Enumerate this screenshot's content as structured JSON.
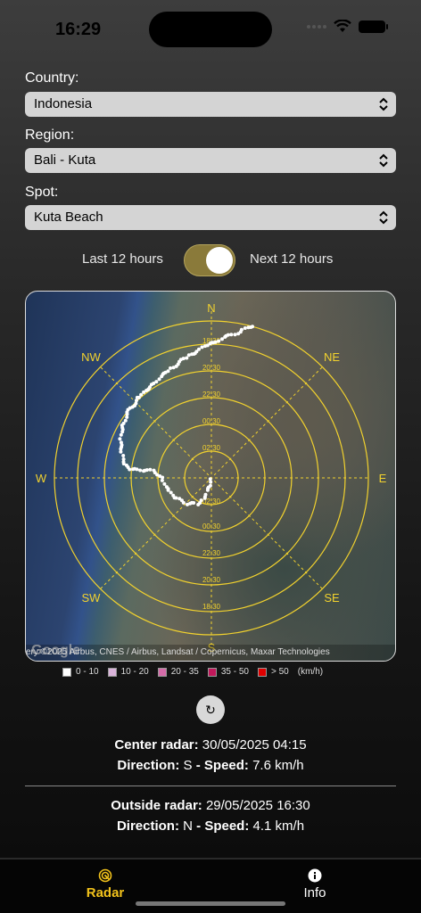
{
  "status": {
    "time": "16:29"
  },
  "form": {
    "country_label": "Country:",
    "country_value": "Indonesia",
    "region_label": "Region:",
    "region_value": "Bali - Kuta",
    "spot_label": "Spot:",
    "spot_value": "Kuta Beach"
  },
  "toggle": {
    "left_label": "Last 12 hours",
    "right_label": "Next 12 hours",
    "on": true,
    "color": "#8a7a3a"
  },
  "radar": {
    "directions": {
      "n": "N",
      "ne": "NE",
      "e": "E",
      "se": "SE",
      "s": "S",
      "sw": "SW",
      "w": "W",
      "nw": "NW"
    },
    "ring_color": "#f2d22e",
    "north_times": [
      "18:30",
      "20:30",
      "22:30",
      "00:30",
      "02:30"
    ],
    "south_times": [
      "02:30",
      "00:30",
      "22:30",
      "20:30",
      "18:30"
    ],
    "attribution": "ery ©2025 Airbus, CNES / Airbus, Landsat / Copernicus, Maxar Technologies",
    "map_logo": "Google"
  },
  "legend": {
    "items": [
      {
        "label": "0 - 10",
        "color": "#ffffff"
      },
      {
        "label": "10 - 20",
        "color": "#d9b3d9"
      },
      {
        "label": "20 - 35",
        "color": "#d36ba8"
      },
      {
        "label": "35 - 50",
        "color": "#c2185b"
      },
      {
        "label": "> 50",
        "color": "#e00000"
      }
    ],
    "unit": "(km/h)"
  },
  "refresh": {
    "icon": "refresh-icon",
    "glyph": "↻"
  },
  "center": {
    "label": "Center radar:",
    "datetime": "30/05/2025 04:15",
    "direction_label": "Direction:",
    "direction": "S",
    "speed_label": "- Speed:",
    "speed": "7.6 km/h"
  },
  "outside": {
    "label": "Outside radar:",
    "datetime": "29/05/2025 16:30",
    "direction_label": "Direction:",
    "direction": "N",
    "speed_label": "- Speed:",
    "speed": "4.1 km/h"
  },
  "tabs": [
    {
      "label": "Radar",
      "icon": "radar-icon",
      "active": true,
      "color": "#f2c21b"
    },
    {
      "label": "Info",
      "icon": "info-icon",
      "active": false,
      "color": "#ffffff"
    }
  ]
}
